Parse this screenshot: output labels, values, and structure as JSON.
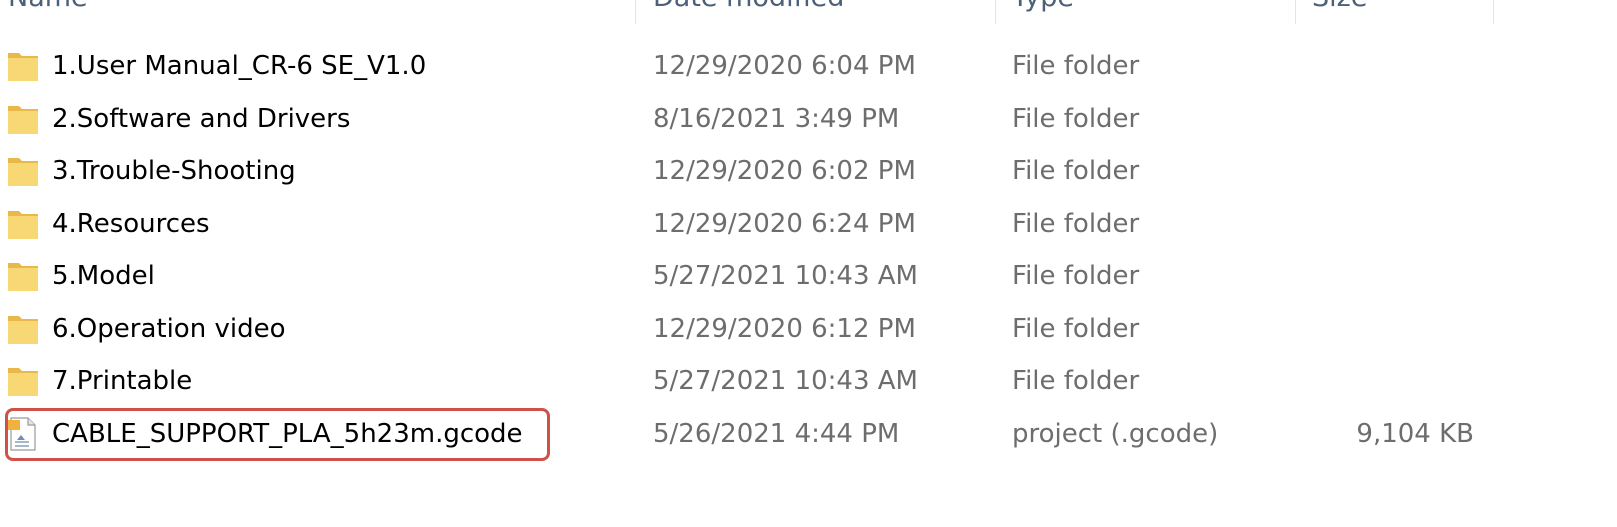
{
  "columns": {
    "name": "Name",
    "date_modified": "Date modified",
    "type": "Type",
    "size": "Size"
  },
  "files": [
    {
      "name": "1.User Manual_CR-6 SE_V1.0",
      "date": "12/29/2020 6:04 PM",
      "type": "File folder",
      "size": "",
      "icon": "folder-icon"
    },
    {
      "name": "2.Software and Drivers",
      "date": "8/16/2021 3:49 PM",
      "type": "File folder",
      "size": "",
      "icon": "folder-icon"
    },
    {
      "name": "3.Trouble-Shooting",
      "date": "12/29/2020 6:02 PM",
      "type": "File folder",
      "size": "",
      "icon": "folder-icon"
    },
    {
      "name": "4.Resources",
      "date": "12/29/2020 6:24 PM",
      "type": "File folder",
      "size": "",
      "icon": "folder-icon"
    },
    {
      "name": "5.Model",
      "date": "5/27/2021 10:43 AM",
      "type": "File folder",
      "size": "",
      "icon": "folder-icon"
    },
    {
      "name": "6.Operation video",
      "date": "12/29/2020 6:12 PM",
      "type": "File folder",
      "size": "",
      "icon": "folder-icon"
    },
    {
      "name": "7.Printable",
      "date": "5/27/2021 10:43 AM",
      "type": "File folder",
      "size": "",
      "icon": "folder-icon"
    },
    {
      "name": "CABLE_SUPPORT_PLA_5h23m.gcode",
      "date": "5/26/2021 4:44 PM",
      "type": "project (.gcode)",
      "size": "9,104 KB",
      "icon": "gcode-file-icon"
    }
  ],
  "colors": {
    "folder": "#f8d775",
    "folder_dark": "#e8b84a",
    "highlight": "#d05147"
  }
}
